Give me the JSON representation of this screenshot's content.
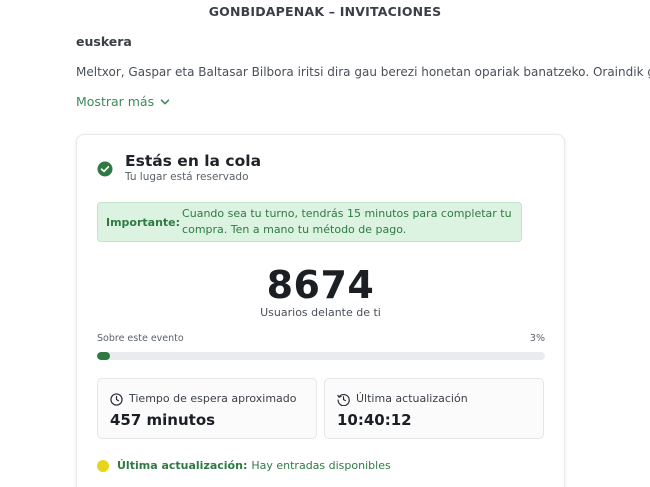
{
  "event": {
    "title": "GONBIDAPENAK – INVITACIONES",
    "language": "euskera",
    "description": "Meltxor, Gaspar eta Baltasar Bilbora iritsi dira gau berezi honetan opariak banatzeko. Oraindik gutune",
    "show_more": "Mostrar más"
  },
  "queue": {
    "status_title": "Estás en la cola",
    "status_subtitle": "Tu lugar está reservado",
    "notice_label": "Importante:",
    "notice_text": "Cuando sea tu turno, tendrás 15 minutos para completar tu compra. Ten a mano tu método de pago.",
    "users_ahead": "8674",
    "users_ahead_label": "Usuarios delante de ti",
    "progress_label": "Sobre este evento",
    "progress_percent_text": "3%",
    "progress_value": 0.03,
    "wait_label": "Tiempo de espera aproximado",
    "wait_value": "457 minutos",
    "update_label": "Última actualización",
    "update_value": "10:40:12",
    "last_update_label": "Última actualización:",
    "last_update_text": "Hay entradas disponibles"
  },
  "colors": {
    "accent_green": "#2f7a43",
    "notice_bg": "#dcf3e2",
    "status_dot": "#e6d51b"
  }
}
